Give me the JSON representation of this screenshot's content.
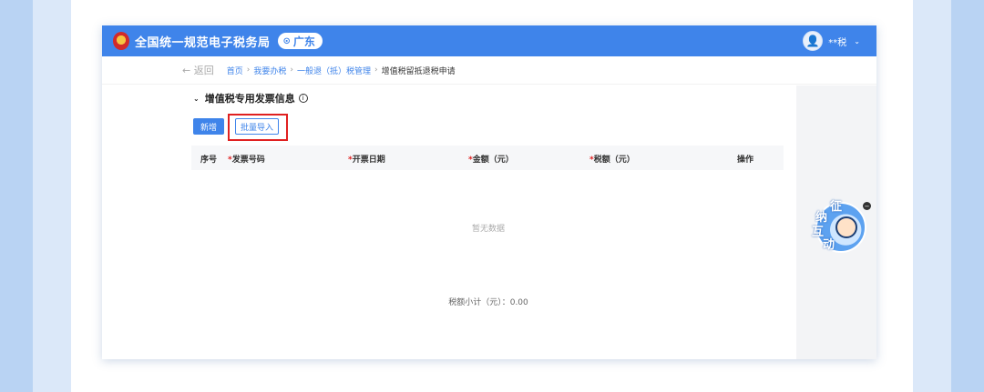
{
  "header": {
    "site_title": "全国统一规范电子税务局",
    "region": "广东",
    "user_name": "**税"
  },
  "breadcrumb": {
    "back_label": "返回",
    "items": [
      "首页",
      "我要办税",
      "一般退（抵）税管理"
    ],
    "current": "增值税留抵退税申请"
  },
  "section": {
    "title": "增值税专用发票信息"
  },
  "toolbar": {
    "add_label": "新增",
    "import_label": "批量导入"
  },
  "table": {
    "columns": [
      "序号",
      "发票号码",
      "开票日期",
      "金额（元）",
      "税额（元）",
      "操作"
    ],
    "empty_text": "暂无数据",
    "subtotal_label": "税额小计（元）：0.00"
  },
  "mascot": {
    "chars": [
      "征",
      "纳",
      "互",
      "动"
    ]
  },
  "colors": {
    "primary": "#3f84ea",
    "highlight": "#e02020"
  }
}
